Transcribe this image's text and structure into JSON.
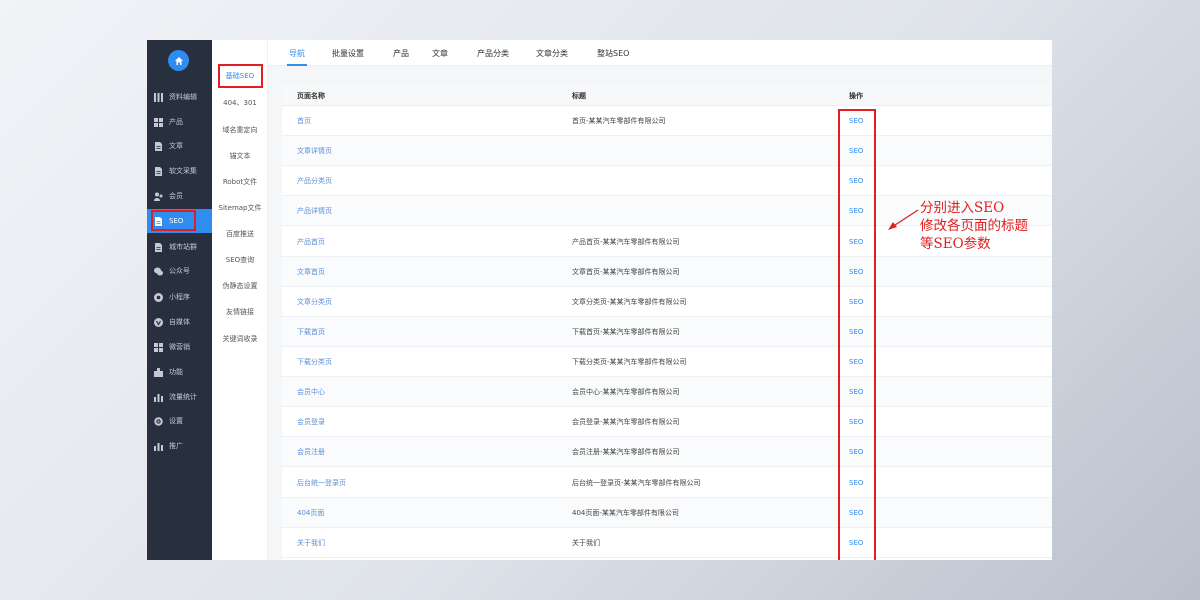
{
  "sidebar": {
    "items": [
      {
        "label": "资料编辑",
        "icon": "columns-icon"
      },
      {
        "label": "产品",
        "icon": "grid-icon"
      },
      {
        "label": "文章",
        "icon": "document-icon"
      },
      {
        "label": "软文采集",
        "icon": "document-icon"
      },
      {
        "label": "会员",
        "icon": "users-icon"
      },
      {
        "label": "SEO",
        "icon": "document-icon"
      },
      {
        "label": "城市站群",
        "icon": "document-icon"
      },
      {
        "label": "公众号",
        "icon": "wechat-icon"
      },
      {
        "label": "小程序",
        "icon": "miniprogram-icon"
      },
      {
        "label": "自媒体",
        "icon": "media-icon"
      },
      {
        "label": "微营销",
        "icon": "grid-icon"
      },
      {
        "label": "功能",
        "icon": "puzzle-icon"
      },
      {
        "label": "流量统计",
        "icon": "bar-chart-icon"
      },
      {
        "label": "设置",
        "icon": "gear-icon"
      },
      {
        "label": "推广",
        "icon": "bar-chart-icon"
      }
    ]
  },
  "submenu": {
    "items": [
      "基础SEO",
      "404、301",
      "域名重定向",
      "锚文本",
      "Robot文件",
      "Sitemap文件",
      "百度推送",
      "SEO查询",
      "伪静态设置",
      "友情链接",
      "关键词收录"
    ]
  },
  "tabs": [
    "导航",
    "批量设置",
    "产品",
    "文章",
    "产品分类",
    "文章分类",
    "整站SEO"
  ],
  "table": {
    "headers": {
      "name": "页面名称",
      "title": "标题",
      "op": "操作"
    },
    "rows": [
      {
        "name": "首页",
        "title": "首页-某某汽车零部件有限公司",
        "op": "SEO"
      },
      {
        "name": "文章详情页",
        "title": "",
        "op": "SEO"
      },
      {
        "name": "产品分类页",
        "title": "",
        "op": "SEO"
      },
      {
        "name": "产品详情页",
        "title": "",
        "op": "SEO"
      },
      {
        "name": "产品首页",
        "title": "产品首页-某某汽车零部件有限公司",
        "op": "SEO"
      },
      {
        "name": "文章首页",
        "title": "文章首页-某某汽车零部件有限公司",
        "op": "SEO"
      },
      {
        "name": "文章分类页",
        "title": "文章分类页-某某汽车零部件有限公司",
        "op": "SEO"
      },
      {
        "name": "下载首页",
        "title": "下载首页-某某汽车零部件有限公司",
        "op": "SEO"
      },
      {
        "name": "下载分类页",
        "title": "下载分类页-某某汽车零部件有限公司",
        "op": "SEO"
      },
      {
        "name": "会员中心",
        "title": "会员中心-某某汽车零部件有限公司",
        "op": "SEO"
      },
      {
        "name": "会员登录",
        "title": "会员登录-某某汽车零部件有限公司",
        "op": "SEO"
      },
      {
        "name": "会员注册",
        "title": "会员注册-某某汽车零部件有限公司",
        "op": "SEO"
      },
      {
        "name": "后台统一登录页",
        "title": "后台统一登录页-某某汽车零部件有限公司",
        "op": "SEO"
      },
      {
        "name": "404页面",
        "title": "404页面-某某汽车零部件有限公司",
        "op": "SEO"
      },
      {
        "name": "关于我们",
        "title": "关于我们",
        "op": "SEO"
      }
    ]
  },
  "annotation": [
    "分别进入SEO",
    "修改各页面的标题",
    "等SEO参数"
  ],
  "colors": {
    "accent": "#2f8cf0",
    "sidebar": "#283040",
    "highlight": "#e02020"
  }
}
